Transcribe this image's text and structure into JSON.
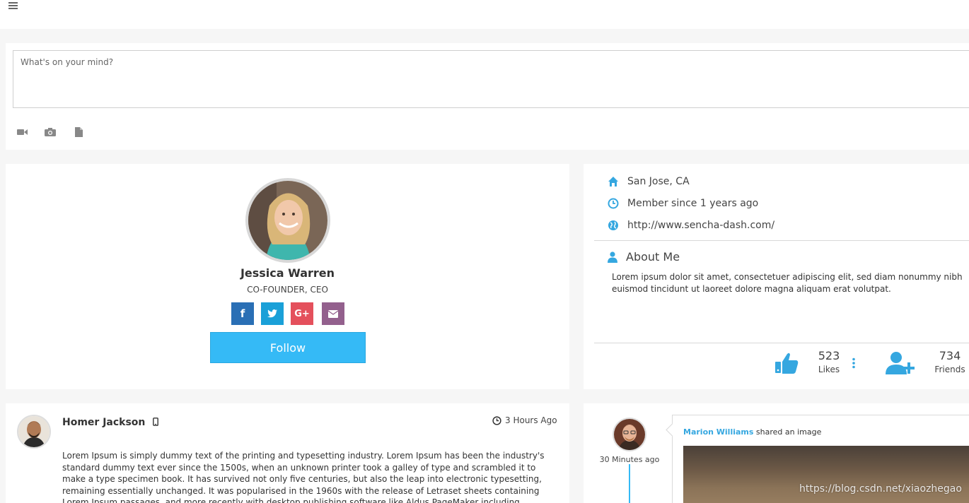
{
  "composer": {
    "placeholder": "What's on your mind?",
    "tools": [
      "video-icon",
      "camera-icon",
      "document-icon"
    ]
  },
  "profile": {
    "name": "Jessica Warren",
    "role": "CO-FOUNDER, CEO",
    "social": [
      {
        "icon": "facebook-icon",
        "glyph": "f",
        "color": "#2a6fb5"
      },
      {
        "icon": "twitter-icon",
        "glyph": "t",
        "color": "#1aa0d8"
      },
      {
        "icon": "google-plus-icon",
        "glyph": "G+",
        "color": "#e4505c"
      },
      {
        "icon": "email-icon",
        "glyph": "",
        "color": "#93608d"
      }
    ],
    "follow_label": "Follow"
  },
  "info": {
    "location": "San Jose, CA",
    "member_since": "Member since 1 years ago",
    "website": "http://www.sencha-dash.com/",
    "about_title": "About Me",
    "about_text": "Lorem ipsum dolor sit amet, consectetuer adipiscing elit, sed diam nonummy nibh euismod tincidunt ut laoreet dolore magna aliquam erat volutpat.",
    "likes_count": "523",
    "likes_label": "Likes",
    "friends_count": "734",
    "friends_label": "Friends"
  },
  "post": {
    "author": "Homer Jackson",
    "time": "3 Hours Ago",
    "body": "Lorem Ipsum is simply dummy text of the printing and typesetting industry. Lorem Ipsum has been the industry's standard dummy text ever since the 1500s, when an unknown printer took a galley of type and scrambled it to make a type specimen book. It has survived not only five centuries, but also the leap into electronic typesetting, remaining essentially unchanged. It was popularised in the 1960s with the release of Letraset sheets containing Lorem Ipsum passages, and more recently with desktop publishing software like Aldus PageMaker including"
  },
  "timeline": {
    "time": "30 Minutes ago",
    "author": "Marion Williams",
    "action": " shared an image"
  },
  "watermark": "https://blog.csdn.net/xiaozhegao",
  "colors": {
    "accent": "#35baf6",
    "background": "#f6f6f6"
  }
}
